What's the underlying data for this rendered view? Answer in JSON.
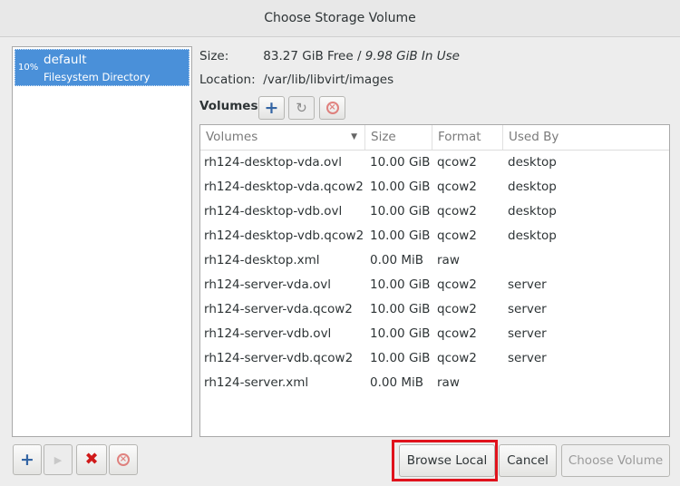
{
  "window": {
    "title": "Choose Storage Volume"
  },
  "pools": [
    {
      "percent": "10%",
      "name": "default",
      "type": "Filesystem Directory"
    }
  ],
  "info": {
    "size_label": "Size:",
    "free": "83.27 GiB Free / ",
    "in_use": "9.98 GiB In Use",
    "location_label": "Location:",
    "location": "/var/lib/libvirt/images"
  },
  "volumes": {
    "label": "Volumes",
    "toolbar_icons": [
      "add-icon",
      "refresh-icon",
      "delete-icon"
    ],
    "columns": [
      "Volumes",
      "Size",
      "Format",
      "Used By"
    ],
    "rows": [
      {
        "name": "rh124-desktop-vda.ovl",
        "size": "10.00 GiB",
        "format": "qcow2",
        "used_by": "desktop"
      },
      {
        "name": "rh124-desktop-vda.qcow2",
        "size": "10.00 GiB",
        "format": "qcow2",
        "used_by": "desktop"
      },
      {
        "name": "rh124-desktop-vdb.ovl",
        "size": "10.00 GiB",
        "format": "qcow2",
        "used_by": "desktop"
      },
      {
        "name": "rh124-desktop-vdb.qcow2",
        "size": "10.00 GiB",
        "format": "qcow2",
        "used_by": "desktop"
      },
      {
        "name": "rh124-desktop.xml",
        "size": "0.00 MiB",
        "format": "raw",
        "used_by": ""
      },
      {
        "name": "rh124-server-vda.ovl",
        "size": "10.00 GiB",
        "format": "qcow2",
        "used_by": "server"
      },
      {
        "name": "rh124-server-vda.qcow2",
        "size": "10.00 GiB",
        "format": "qcow2",
        "used_by": "server"
      },
      {
        "name": "rh124-server-vdb.ovl",
        "size": "10.00 GiB",
        "format": "qcow2",
        "used_by": "server"
      },
      {
        "name": "rh124-server-vdb.qcow2",
        "size": "10.00 GiB",
        "format": "qcow2",
        "used_by": "server"
      },
      {
        "name": "rh124-server.xml",
        "size": "0.00 MiB",
        "format": "raw",
        "used_by": ""
      }
    ]
  },
  "pool_toolbar_icons": [
    "add-pool-icon",
    "start-pool-icon",
    "delete-pool-icon",
    "stop-pool-icon"
  ],
  "buttons": {
    "browse_local": "Browse Local",
    "cancel": "Cancel",
    "choose_volume": "Choose Volume"
  },
  "colors": {
    "selection": "#4a90d9",
    "highlight_box": "#e0121c"
  }
}
